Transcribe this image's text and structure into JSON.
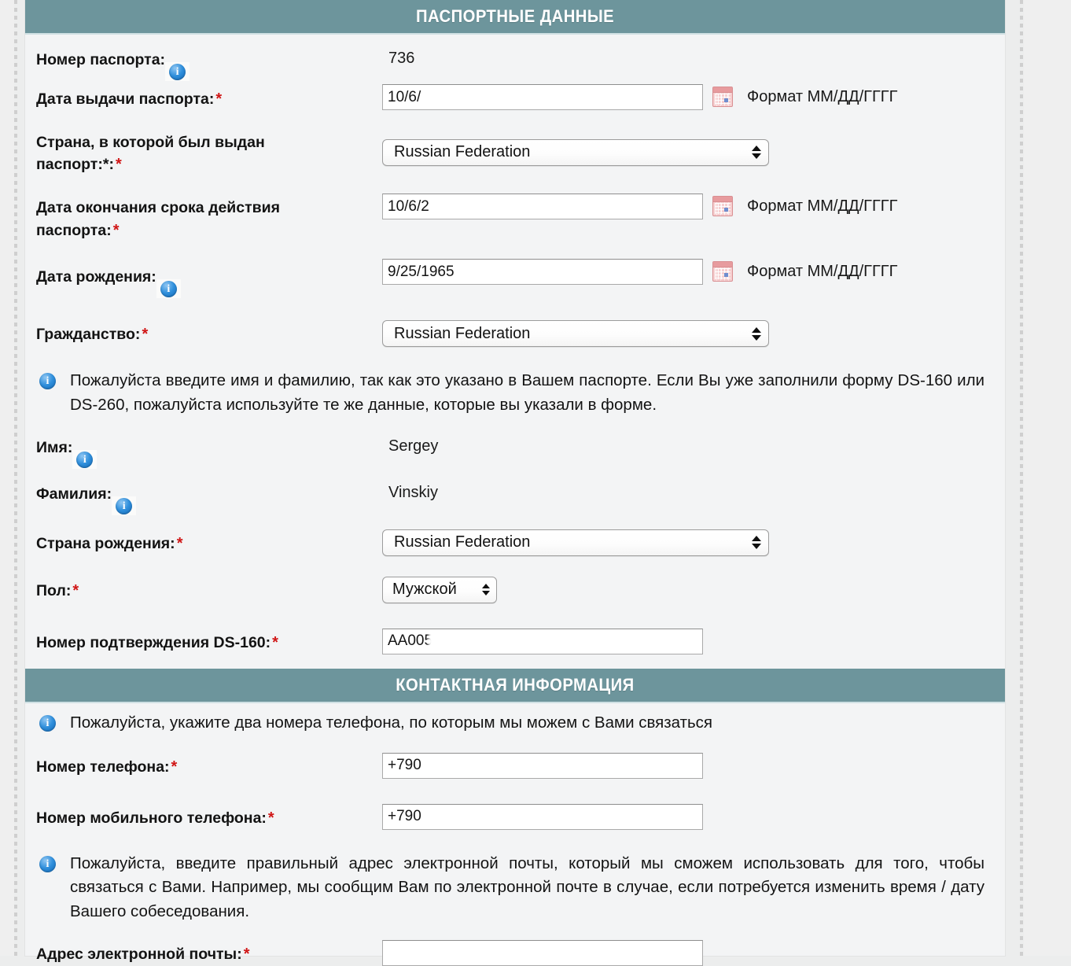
{
  "sections": [
    {
      "id": "passport",
      "title": "ПАСПОРТНЫЕ ДАННЫЕ"
    },
    {
      "id": "contact",
      "title": "КОНТАКТНАЯ ИНФОРМАЦИЯ"
    }
  ],
  "passport": {
    "title": "ПАСПОРТНЫЕ ДАННЫЕ",
    "passport_number": {
      "label": "Номер паспорта:",
      "value": "736",
      "info_icon": "info-icon"
    },
    "issue_date": {
      "label": "Дата выдачи паспорта:",
      "required": "*",
      "value": "10/6/",
      "hint": "Формат ММ/ДД/ГГГГ",
      "calendar_icon": "calendar-icon"
    },
    "issuing_country": {
      "label_line1": "Страна, в которой был выдан",
      "label_line2": "паспорт:*:",
      "required": "*",
      "value": "Russian Federation"
    },
    "expiry_date": {
      "label_line1": "Дата окончания срока действия",
      "label_line2": "паспорта:",
      "required": "*",
      "value": "10/6/2",
      "hint": "Формат ММ/ДД/ГГГГ",
      "calendar_icon": "calendar-icon"
    },
    "birth_date": {
      "label": "Дата рождения:",
      "value": "9/25/1965",
      "hint": "Формат ММ/ДД/ГГГГ",
      "info_icon": "info-icon",
      "calendar_icon": "calendar-icon"
    },
    "citizenship": {
      "label": "Гражданство:",
      "required": "*",
      "value": "Russian Federation"
    },
    "name_notice": "Пожалуйста введите имя и фамилию, так как это указано в Вашем паспорте. Если Вы уже заполнили форму DS-160 или DS-260, пожалуйста используйте те же данные, которые вы указали в форме.",
    "first_name": {
      "label": "Имя:",
      "value": "Sergey",
      "info_icon": "info-icon"
    },
    "last_name": {
      "label": "Фамилия:",
      "value": "Vinskiy",
      "info_icon": "info-icon"
    },
    "birth_country": {
      "label": "Страна рождения:",
      "required": "*",
      "value": "Russian Federation"
    },
    "gender": {
      "label": "Пол:",
      "required": "*",
      "value": "Мужской"
    },
    "ds160": {
      "label": "Номер подтверждения DS-160:",
      "required": "*",
      "value": "AA005"
    }
  },
  "contact": {
    "title": "КОНТАКТНАЯ ИНФОРМАЦИЯ",
    "phone_notice": "Пожалуйста, укажите два номера телефона, по которым мы можем с Вами связаться",
    "phone": {
      "label": "Номер телефона:",
      "required": "*",
      "value": "+790"
    },
    "mobile": {
      "label": "Номер мобильного телефона:",
      "required": "*",
      "value": "+790"
    },
    "email_notice": "Пожалуйста, введите правильный адрес электронной почты, который мы сможем использовать для того, чтобы связаться с Вами. Например, мы сообщим Вам по электронной почте в случае, если потребуется изменить время / дату Вашего собеседования.",
    "email": {
      "label": "Адрес электронной почты:",
      "required": "*",
      "value": ""
    }
  },
  "colors": {
    "section_bar": "#6d959c",
    "required_star": "#d01616",
    "info_icon": "#2f8fdc",
    "page_bg": "#f3f4f5",
    "calendar_icon": "#e79b9e"
  }
}
